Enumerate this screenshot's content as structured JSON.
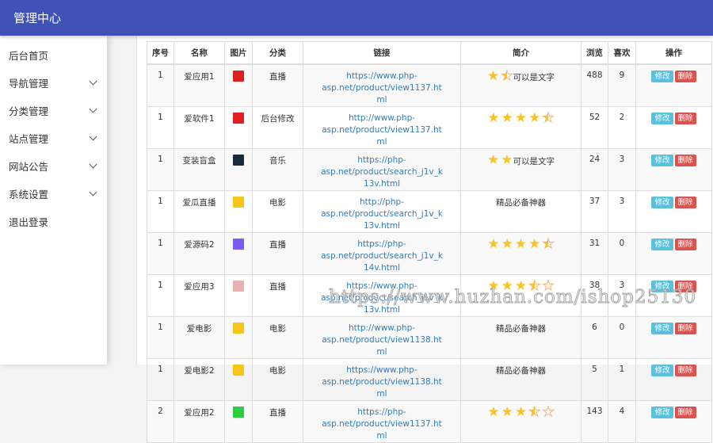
{
  "header": {
    "title": "管理中心"
  },
  "sidebar": {
    "items": [
      {
        "label": "后台首页",
        "expandable": false
      },
      {
        "label": "导航管理",
        "expandable": true
      },
      {
        "label": "分类管理",
        "expandable": true
      },
      {
        "label": "站点管理",
        "expandable": true
      },
      {
        "label": "网站公告",
        "expandable": true
      },
      {
        "label": "系统设置",
        "expandable": true
      },
      {
        "label": "退出登录",
        "expandable": false
      }
    ]
  },
  "table": {
    "columns": [
      "序号",
      "名称",
      "图片",
      "分类",
      "链接",
      "简介",
      "浏览",
      "喜欢",
      "操作"
    ],
    "edit_label": "修改",
    "delete_label": "删除",
    "rows": [
      {
        "id": "1",
        "name": "爱应用1",
        "pic_color": "#e02020",
        "category": "直播",
        "link": "https://www.php-asp.net/product/view1137.html",
        "rating": 1.5,
        "rating_max": 2,
        "intro": "可以是文字",
        "views": "488",
        "likes": "9"
      },
      {
        "id": "1",
        "name": "爱软件1",
        "pic_color": "#e02020",
        "category": "后台修改",
        "link": "http://www.php-asp.net/product/view1137.html",
        "rating": 4.5,
        "rating_max": 5,
        "intro": "",
        "views": "52",
        "likes": "2"
      },
      {
        "id": "1",
        "name": "变装盲盒",
        "pic_color": "#1a2a3a",
        "category": "音乐",
        "link": "https://php-asp.net/product/search_j1v_k13v.html",
        "rating": 2,
        "rating_max": 2,
        "intro": "可以是文字",
        "views": "24",
        "likes": "3"
      },
      {
        "id": "1",
        "name": "爱瓜直播",
        "pic_color": "#f5c518",
        "category": "电影",
        "link": "http://php-asp.net/product/search_j1v_k13v.html",
        "rating": 0,
        "rating_max": 0,
        "intro": "精品必备神器",
        "views": "37",
        "likes": "3"
      },
      {
        "id": "1",
        "name": "爱源码2",
        "pic_color": "#7b5cf0",
        "category": "直播",
        "link": "https://php-asp.net/product/search_j1v_k14v.html",
        "rating": 4.5,
        "rating_max": 5,
        "intro": "",
        "views": "31",
        "likes": "0"
      },
      {
        "id": "1",
        "name": "爱应用3",
        "pic_color": "#e8b0b0",
        "category": "直播",
        "link": "https://www.php-asp.net/product/search_j1v_k13v.html",
        "rating": 3.5,
        "rating_max": 5,
        "intro": "",
        "views": "38",
        "likes": "3"
      },
      {
        "id": "1",
        "name": "爱电影",
        "pic_color": "#f5c518",
        "category": "电影",
        "link": "http://www.php-asp.net/product/view1138.html",
        "rating": 0,
        "rating_max": 0,
        "intro": "精品必备神器",
        "views": "6",
        "likes": "0"
      },
      {
        "id": "1",
        "name": "爱电影2",
        "pic_color": "#f5c518",
        "category": "电影",
        "link": "https://www.php-asp.net/product/view1138.html",
        "rating": 0,
        "rating_max": 0,
        "intro": "精品必备神器",
        "views": "5",
        "likes": "1"
      },
      {
        "id": "2",
        "name": "爱应用2",
        "pic_color": "#2ecc40",
        "category": "直播",
        "link": "https://php-asp.net/product/view1137.html",
        "rating": 3.5,
        "rating_max": 5,
        "intro": "",
        "views": "143",
        "likes": "4"
      }
    ]
  },
  "watermark": "https://www.huzhan.com/ishop25130"
}
